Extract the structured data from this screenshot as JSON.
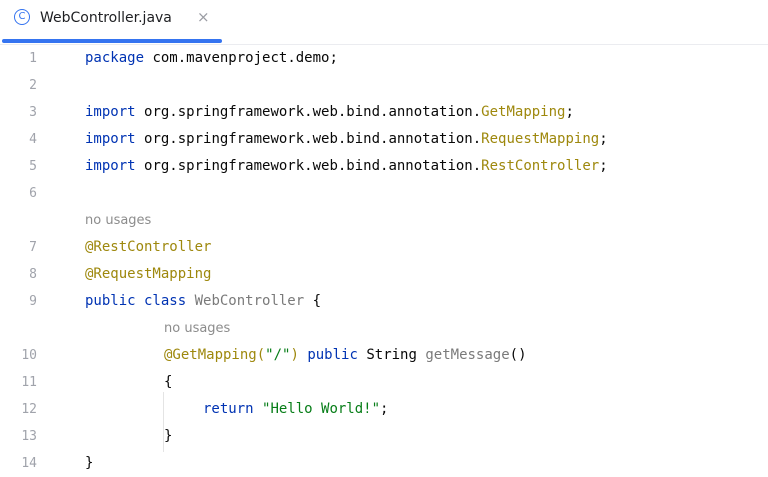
{
  "tab": {
    "icon_glyph": "C",
    "title": "WebController.java",
    "close_glyph": "×"
  },
  "editor": {
    "hint_no_usages": "no usages",
    "lines": [
      {
        "num": "1",
        "package_kw": "package",
        "package_name": "com.mavenproject.demo;"
      },
      {
        "num": "2"
      },
      {
        "num": "3",
        "import_kw": "import",
        "path": "org.springframework.web.bind.annotation.",
        "cls": "GetMapping",
        "semi": ";"
      },
      {
        "num": "4",
        "import_kw": "import",
        "path": "org.springframework.web.bind.annotation.",
        "cls": "RequestMapping",
        "semi": ";"
      },
      {
        "num": "5",
        "import_kw": "import",
        "path": "org.springframework.web.bind.annotation.",
        "cls": "RestController",
        "semi": ";"
      },
      {
        "num": "6"
      },
      {
        "num": "7",
        "text": "@RestController"
      },
      {
        "num": "8",
        "text": "@RequestMapping"
      },
      {
        "num": "9",
        "kw": "public class",
        "name": "WebController",
        "brace": "{"
      },
      {
        "num": "10",
        "annotation": "@GetMapping(",
        "arg": "\"/\"",
        "close_paren": ")",
        "kw": "public",
        "type": "String",
        "method": "getMessage",
        "parens": "()"
      },
      {
        "num": "11",
        "brace": "{"
      },
      {
        "num": "12",
        "kw": "return",
        "str": "\"Hello World!\"",
        "semi": ";"
      },
      {
        "num": "13",
        "brace": "}"
      },
      {
        "num": "14",
        "brace": "}"
      }
    ]
  },
  "colors": {
    "accent": "#3574f0",
    "keyword": "#0033b3",
    "annotation": "#9e880d",
    "string": "#067d17",
    "line_number": "#a0a3ab",
    "hint": "#8c8c8c"
  }
}
